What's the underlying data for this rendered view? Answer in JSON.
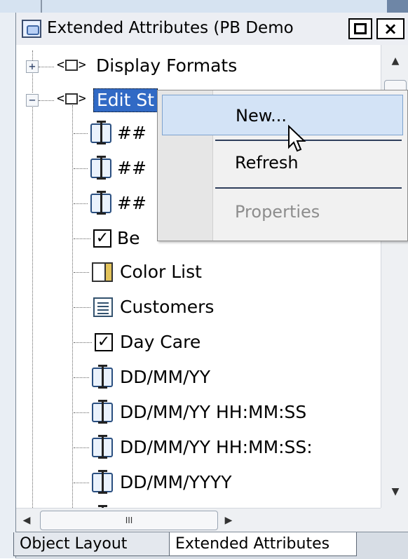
{
  "window": {
    "title": "Extended Attributes (PB Demo",
    "maximize_symbol": "□",
    "close_symbol": "×"
  },
  "tree": {
    "nodes": [
      {
        "label": "Display Formats",
        "expander": "+",
        "icon": "tag-icon"
      },
      {
        "label": "Edit St",
        "expander": "−",
        "icon": "tag-icon",
        "selected": true
      },
      {
        "label": "##",
        "icon": "edit-mask-icon"
      },
      {
        "label": "##",
        "icon": "edit-mask-icon"
      },
      {
        "label": "##",
        "icon": "edit-mask-icon"
      },
      {
        "label": "Be",
        "icon": "checkbox-icon"
      },
      {
        "label": "Color List",
        "icon": "color-list-icon"
      },
      {
        "label": "Customers",
        "icon": "list-icon"
      },
      {
        "label": "Day Care",
        "icon": "checkbox-icon"
      },
      {
        "label": "DD/MM/YY",
        "icon": "edit-mask-icon"
      },
      {
        "label": "DD/MM/YY HH:MM:SS",
        "icon": "edit-mask-icon"
      },
      {
        "label": "DD/MM/YY HH:MM:SS:",
        "icon": "edit-mask-icon"
      },
      {
        "label": "DD/MM/YYYY",
        "icon": "edit-mask-icon"
      }
    ]
  },
  "context_menu": {
    "items": [
      {
        "label": "New...",
        "state": "hover"
      },
      {
        "label": "Refresh",
        "state": "normal"
      },
      {
        "label": "Properties",
        "state": "disabled"
      }
    ]
  },
  "scrollbar": {
    "h_thumb_grip": "III"
  },
  "tabs": {
    "object_layout": "Object Layout",
    "extended_attributes": "Extended Attributes",
    "active": "Extended Attributes"
  }
}
